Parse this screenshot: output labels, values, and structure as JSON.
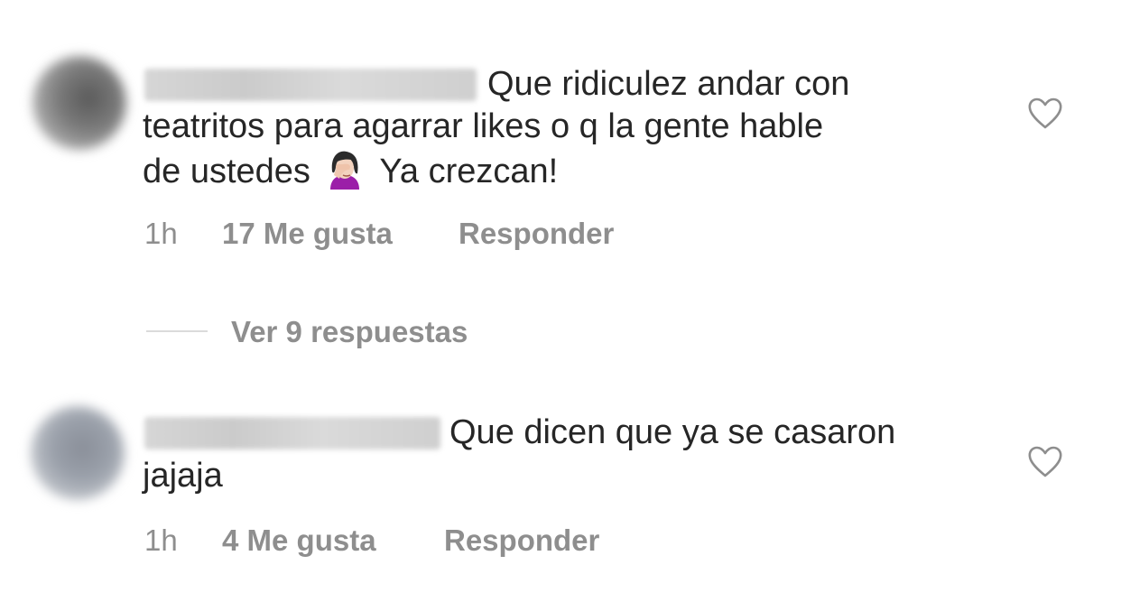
{
  "comments": [
    {
      "text_first": "Que ridiculez andar con",
      "text_second": "teatritos para agarrar likes o q la gente hable",
      "text_third_before": "de ustedes",
      "emoji": "woman-facepalming-emoji",
      "text_third_after": "Ya crezcan!",
      "time": "1h",
      "likes": "17 Me gusta",
      "reply_label": "Responder",
      "like_icon": "heart-outline-icon"
    },
    {
      "text_first": "Que dicen que ya se casaron",
      "text_second": "jajaja",
      "time": "1h",
      "likes": "4 Me gusta",
      "reply_label": "Responder",
      "like_icon": "heart-outline-icon"
    }
  ],
  "view_replies_label": "Ver 9 respuestas",
  "colors": {
    "text": "#262626",
    "secondary": "#8e8e8e",
    "divider": "#dbdbdb"
  }
}
